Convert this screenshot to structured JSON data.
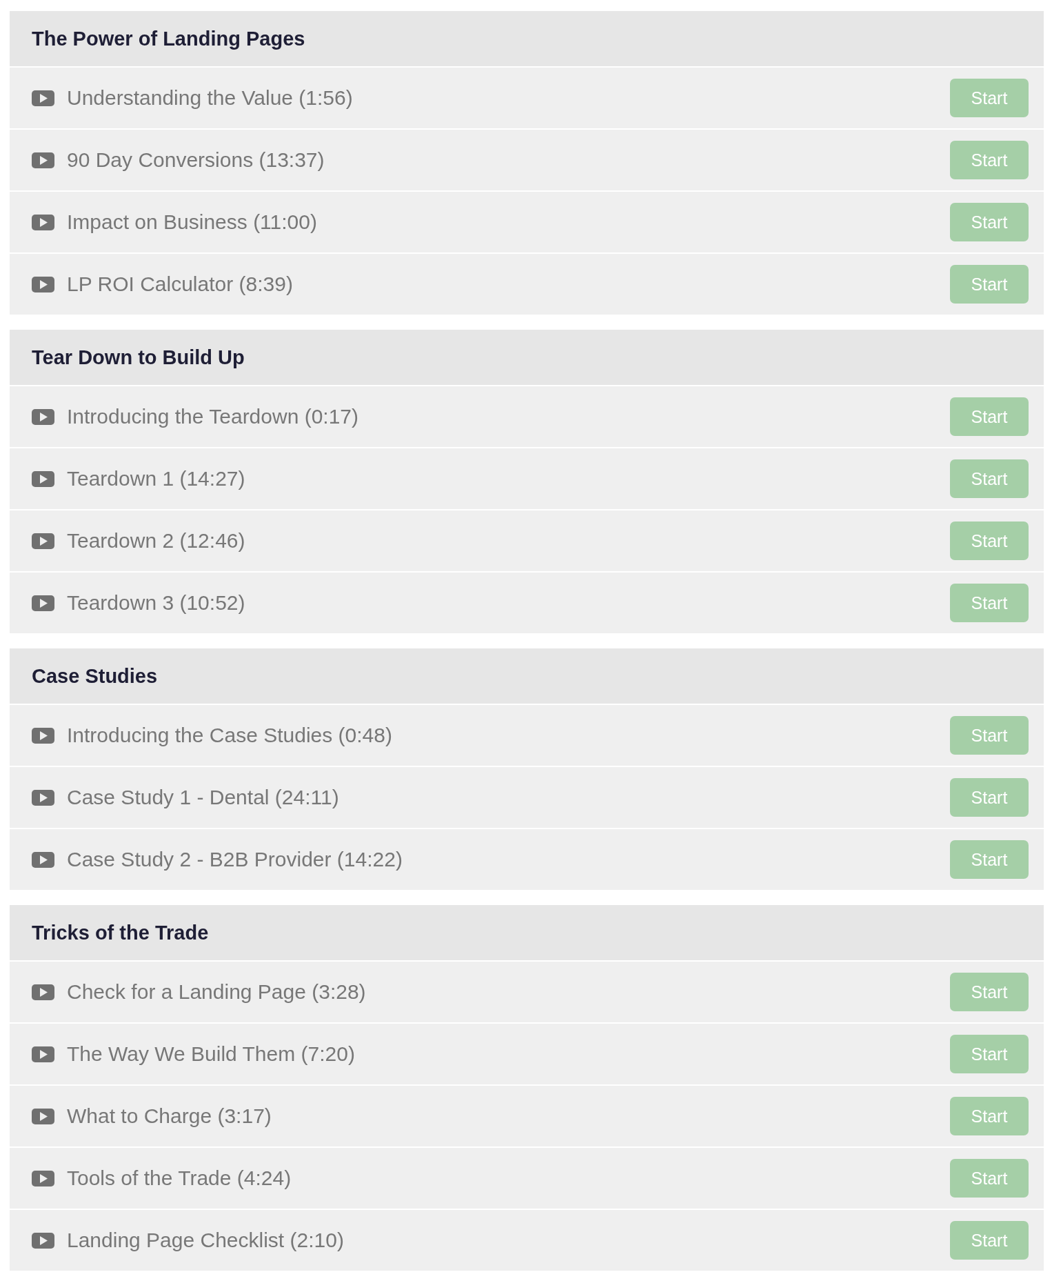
{
  "sections": [
    {
      "title": "The Power of Landing Pages",
      "lessons": [
        {
          "title": "Understanding the Value (1:56)",
          "button": "Start"
        },
        {
          "title": "90 Day Conversions (13:37)",
          "button": "Start"
        },
        {
          "title": "Impact on Business (11:00)",
          "button": "Start"
        },
        {
          "title": "LP ROI Calculator (8:39)",
          "button": "Start"
        }
      ]
    },
    {
      "title": "Tear Down to Build Up",
      "lessons": [
        {
          "title": "Introducing the Teardown (0:17)",
          "button": "Start"
        },
        {
          "title": "Teardown 1 (14:27)",
          "button": "Start"
        },
        {
          "title": "Teardown 2 (12:46)",
          "button": "Start"
        },
        {
          "title": "Teardown 3 (10:52)",
          "button": "Start"
        }
      ]
    },
    {
      "title": "Case Studies",
      "lessons": [
        {
          "title": "Introducing the Case Studies (0:48)",
          "button": "Start"
        },
        {
          "title": "Case Study 1 - Dental (24:11)",
          "button": "Start"
        },
        {
          "title": "Case Study 2 - B2B Provider (14:22)",
          "button": "Start"
        }
      ]
    },
    {
      "title": "Tricks of the Trade",
      "lessons": [
        {
          "title": "Check for a Landing Page (3:28)",
          "button": "Start"
        },
        {
          "title": "The Way We Build Them (7:20)",
          "button": "Start"
        },
        {
          "title": "What to Charge (3:17)",
          "button": "Start"
        },
        {
          "title": "Tools of the Trade (4:24)",
          "button": "Start"
        },
        {
          "title": "Landing Page Checklist (2:10)",
          "button": "Start"
        }
      ]
    }
  ]
}
